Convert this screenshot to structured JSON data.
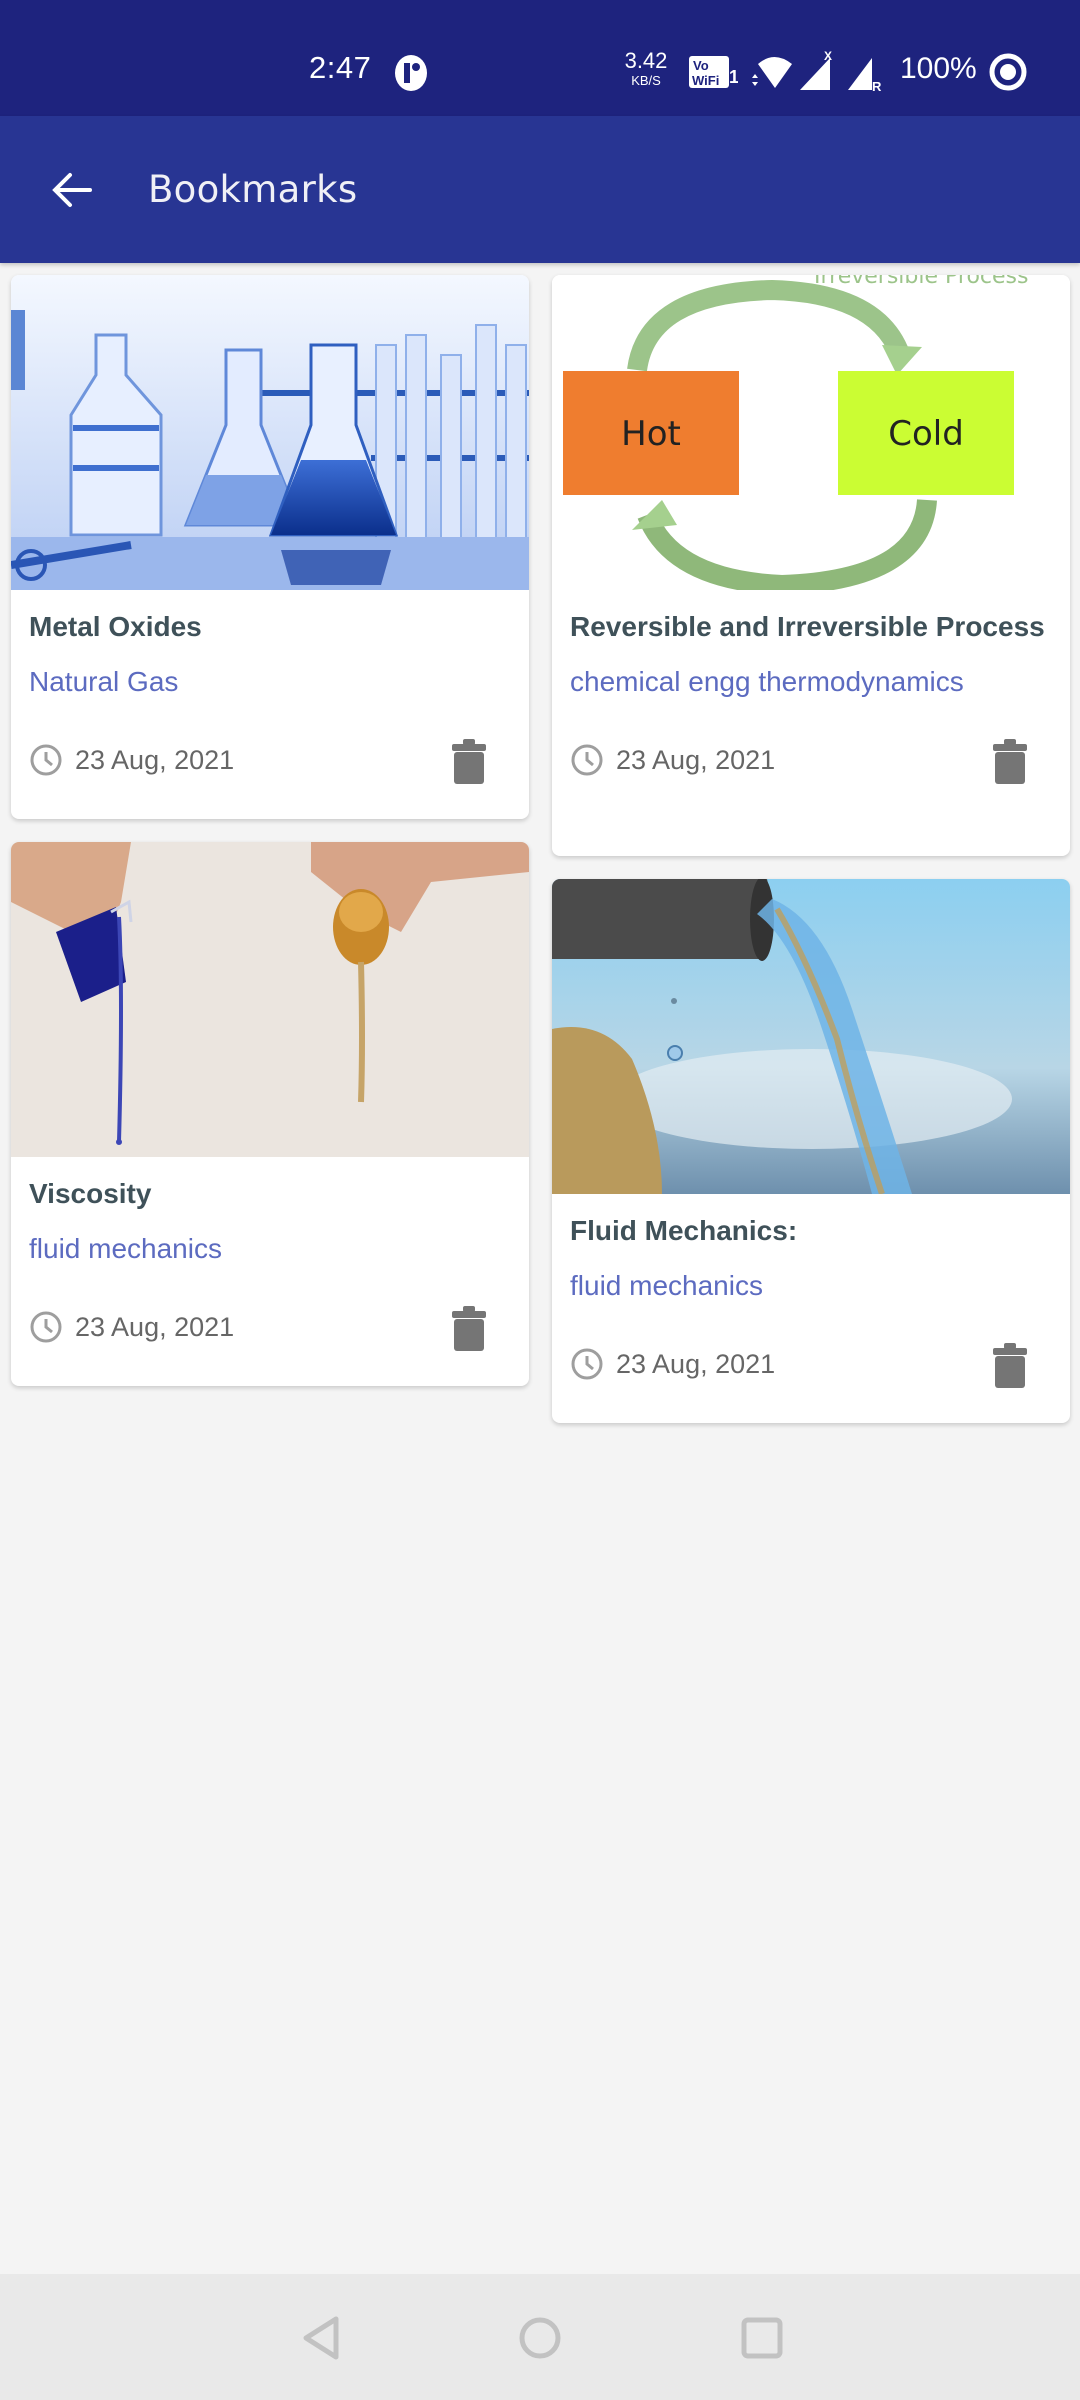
{
  "status_bar": {
    "time": "2:47",
    "net_speed_value": "3.42",
    "net_speed_unit": "KB/S",
    "vowifi_label": "Vo WiFi 1",
    "battery": "100%"
  },
  "app_bar": {
    "title": "Bookmarks",
    "back_icon": "arrow-left-icon"
  },
  "bookmarks": [
    {
      "title": "Metal Oxides",
      "category": "Natural Gas",
      "date": "23 Aug, 2021",
      "image": "laboratory-glassware-blue"
    },
    {
      "title": "Reversible and Irreversible Process",
      "category": "chemical engg thermodynamics",
      "date": "23 Aug, 2021",
      "image": "hot-cold-cycle-diagram",
      "image_labels": {
        "hot": "Hot",
        "cold": "Cold",
        "caption": "Irreversible Process"
      }
    },
    {
      "title": "Viscosity",
      "category": "fluid mechanics",
      "date": "23 Aug, 2021",
      "image": "pouring-liquids"
    },
    {
      "title": "Fluid Mechanics:",
      "category": "fluid mechanics",
      "date": "23 Aug, 2021",
      "image": "water-from-pipe"
    }
  ],
  "colors": {
    "status_bar": "#1e237e",
    "app_bar": "#283593",
    "title_text": "#3f5159",
    "category_text": "#5c6bc0",
    "background": "#f4f4f4"
  },
  "nav_bar": {
    "back": "nav-back-icon",
    "home": "nav-home-icon",
    "recents": "nav-recents-icon"
  }
}
